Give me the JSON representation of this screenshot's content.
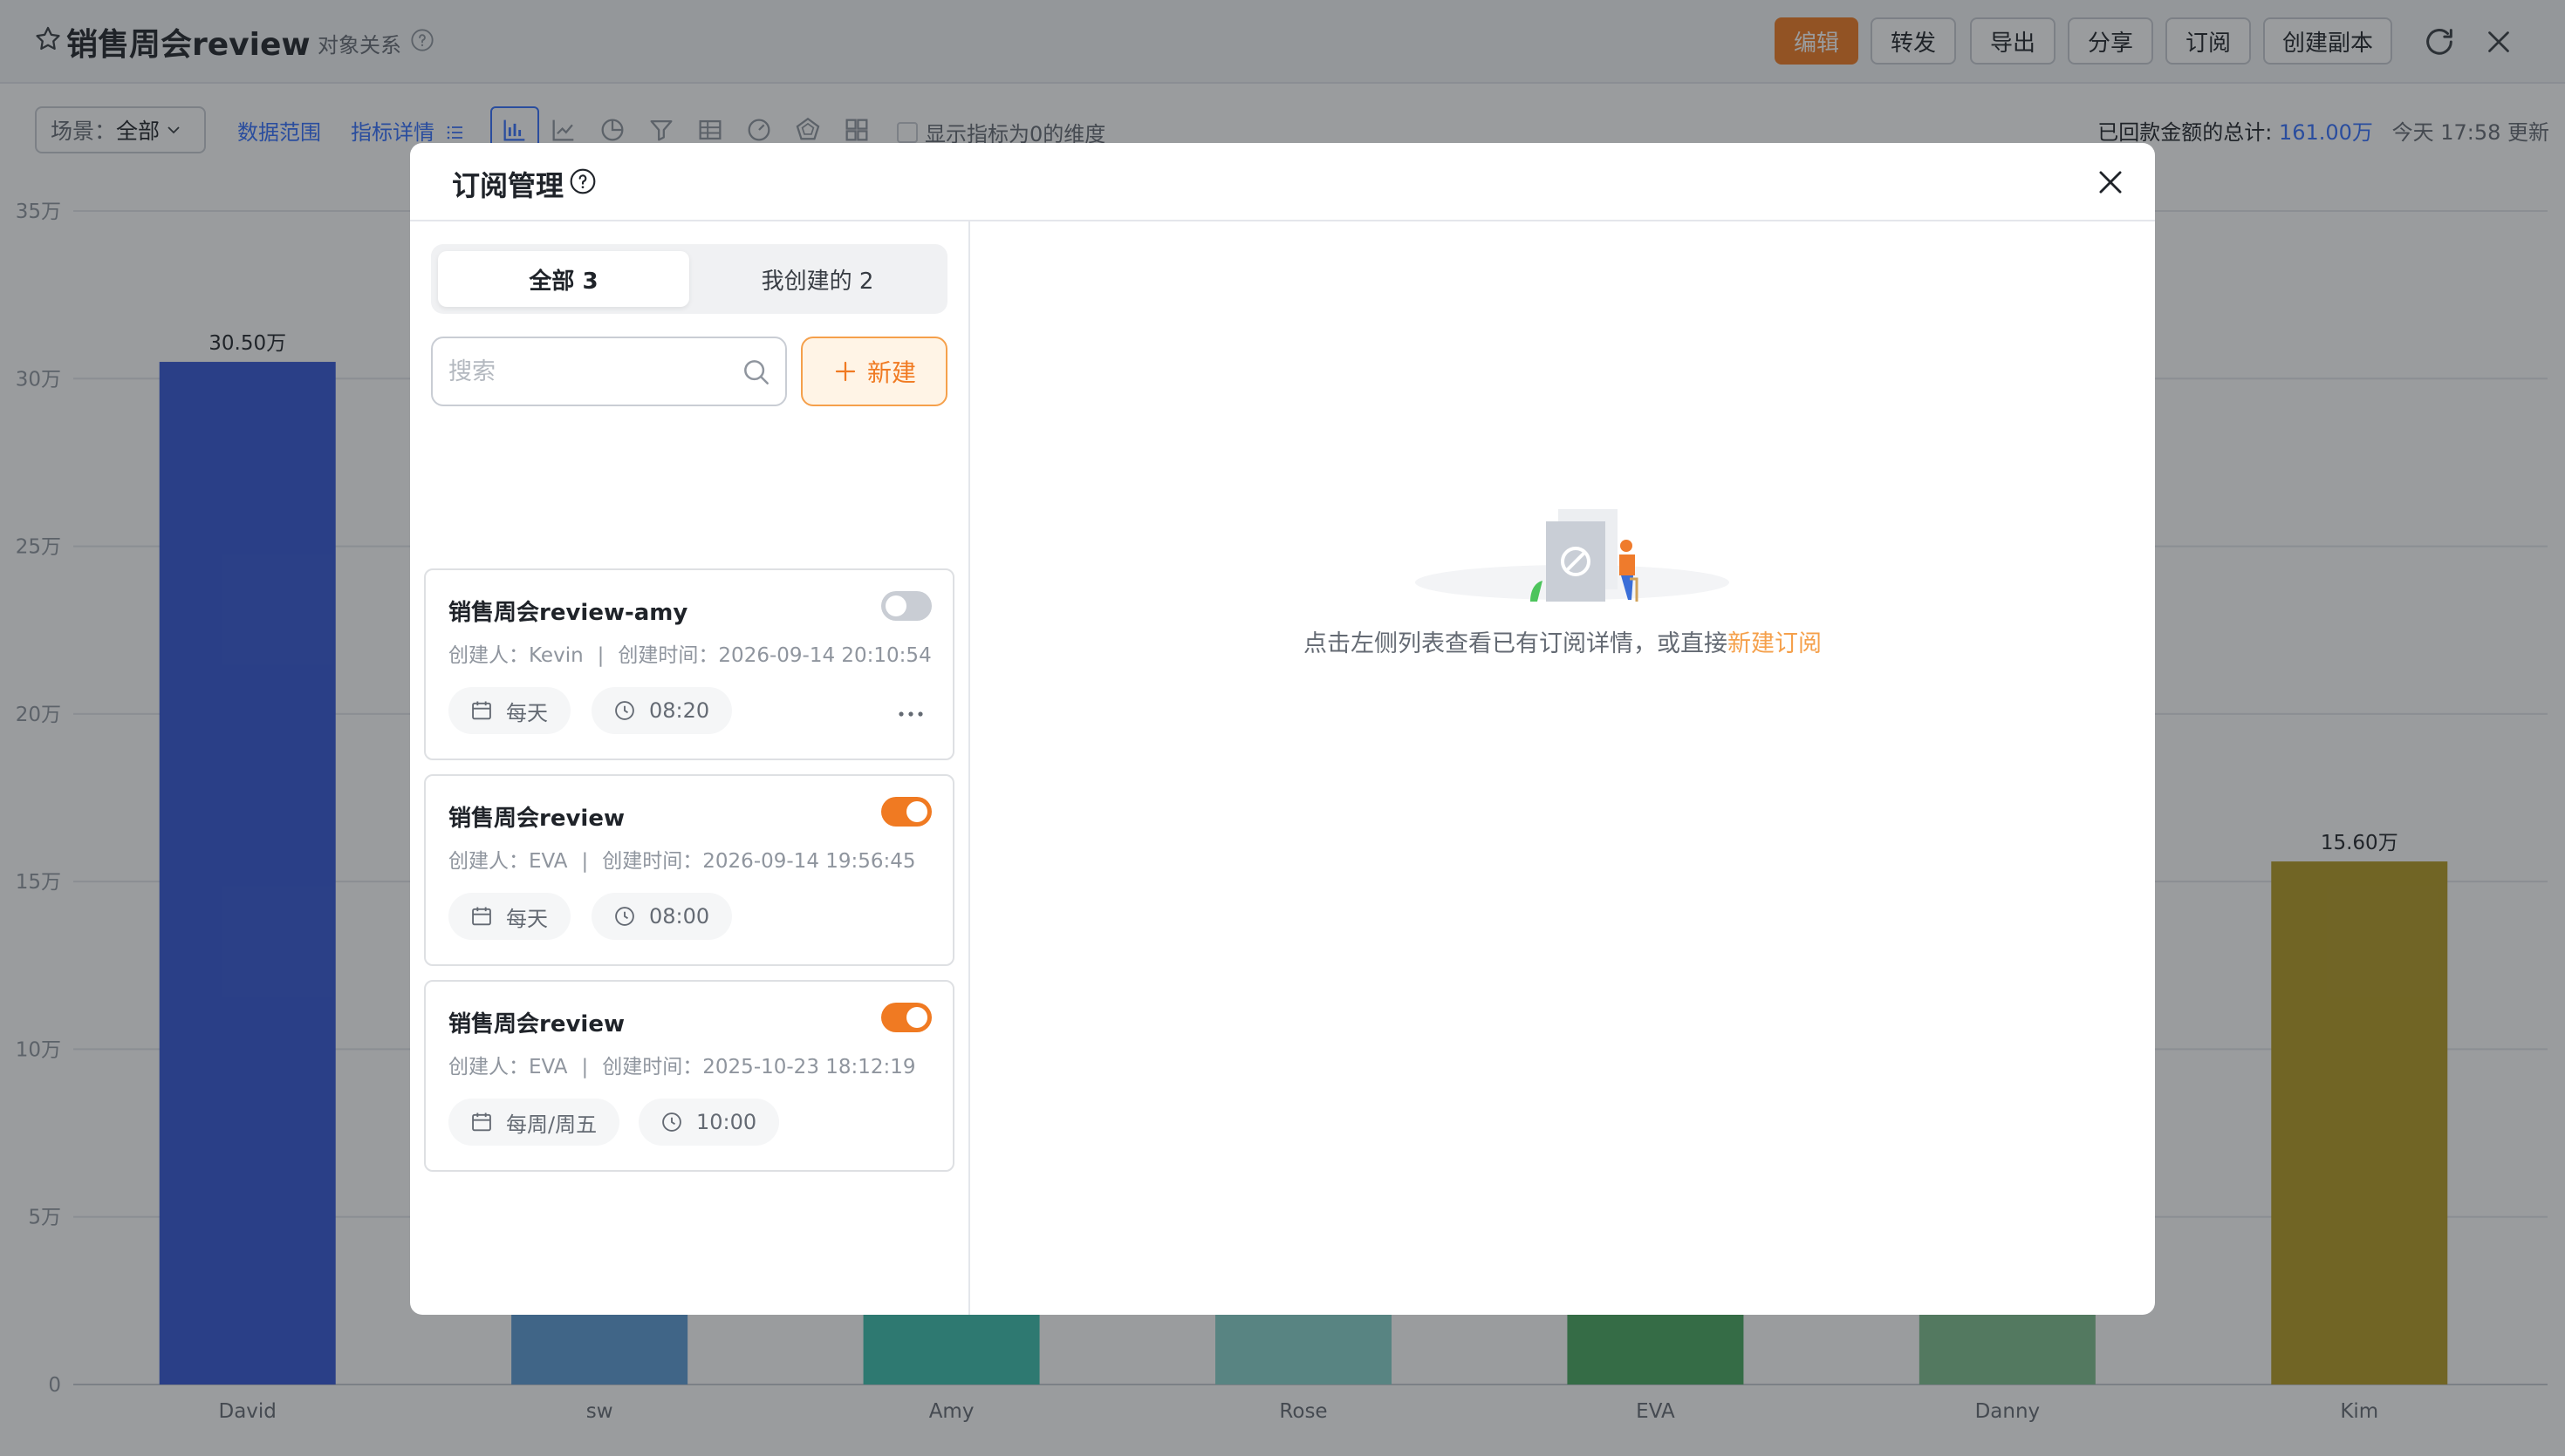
{
  "header": {
    "title": "销售周会review",
    "relation_link": "对象关系",
    "buttons": {
      "edit": "编辑",
      "forward": "转发",
      "export": "导出",
      "share": "分享",
      "subscribe": "订阅",
      "copy": "创建副本"
    }
  },
  "toolbar": {
    "scene_label": "场景：",
    "scene_value": "全部",
    "data_range": "数据范围",
    "metric_details": "指标详情",
    "show_zero_label": "显示指标为0的维度",
    "total_label": "已回款金额的总计:",
    "total_value": "161.00万",
    "updated": "今天 17:58 更新"
  },
  "chart_data": {
    "type": "bar",
    "categories": [
      "David",
      "sw",
      "Amy",
      "Rose",
      "EVA",
      "Danny",
      "Kim"
    ],
    "values": [
      305000,
      null,
      null,
      null,
      null,
      null,
      156000
    ],
    "data_labels": [
      "30.50万",
      "",
      "",
      "",
      "",
      "",
      "15.60万"
    ],
    "colors": [
      "#3457d5",
      "#5b9bd5",
      "#3bbfad",
      "#88d3cc",
      "#47a85f",
      "#7fbf8e",
      "#b59c24"
    ],
    "ylim": [
      0,
      350000
    ],
    "yticks": [
      "0",
      "5万",
      "10万",
      "15万",
      "20万",
      "25万",
      "30万",
      "35万"
    ],
    "grid": true
  },
  "modal": {
    "title": "订阅管理",
    "tabs": {
      "all": "全部 3",
      "mine": "我创建的 2"
    },
    "search_placeholder": "搜索",
    "new_button": "新建",
    "subscriptions": [
      {
        "name": "销售周会review-amy",
        "enabled": false,
        "creator": "创建人：Kevin",
        "created": "创建时间：2026-09-14 20:10:54",
        "frequency": "每天",
        "time": "08:20"
      },
      {
        "name": "销售周会review",
        "enabled": true,
        "creator": "创建人：EVA",
        "created": "创建时间：2026-09-14 19:56:45",
        "frequency": "每天",
        "time": "08:00"
      },
      {
        "name": "销售周会review",
        "enabled": true,
        "creator": "创建人：EVA",
        "created": "创建时间：2025-10-23 18:12:19",
        "frequency": "每周/周五",
        "time": "10:00"
      }
    ],
    "empty_hint": "点击左侧列表查看已有订阅详情，或直接",
    "empty_link": "新建订阅"
  }
}
